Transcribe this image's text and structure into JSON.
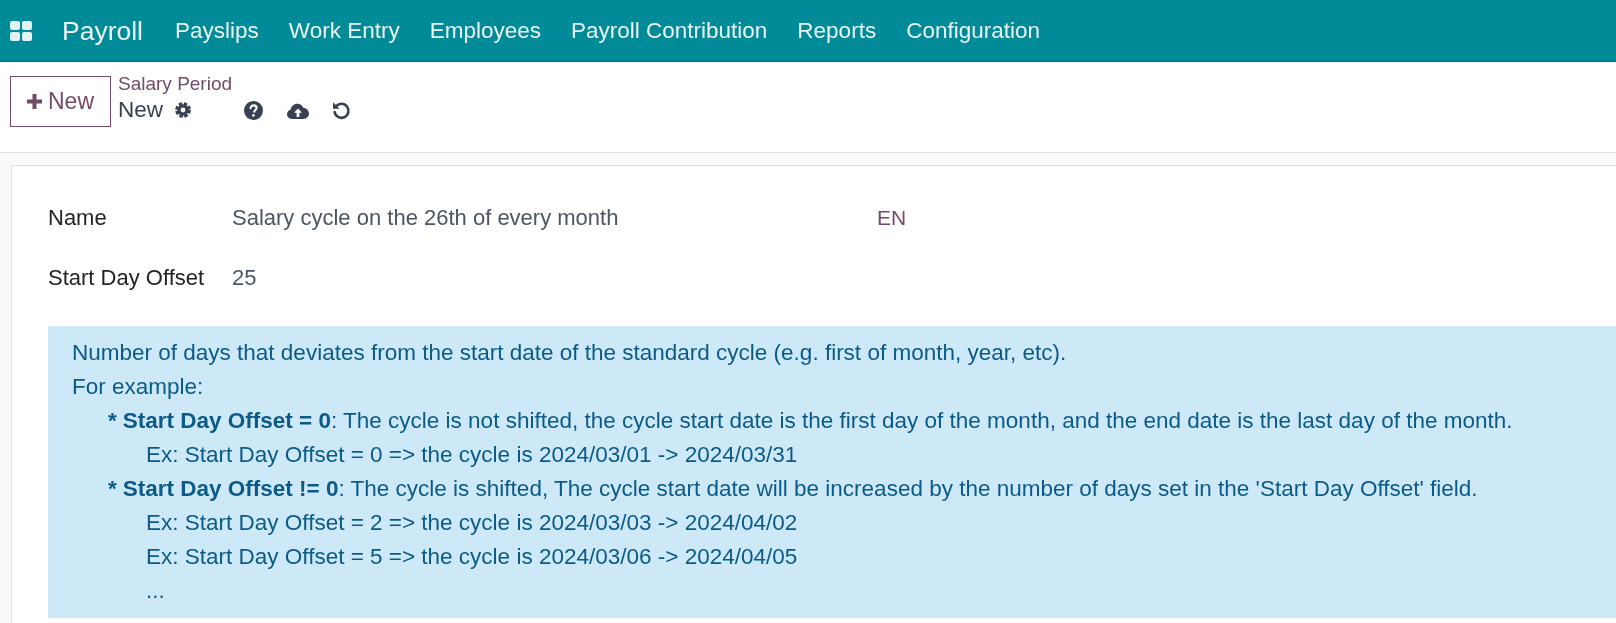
{
  "navbar": {
    "app_name": "Payroll",
    "menu": [
      {
        "label": "Payslips"
      },
      {
        "label": "Work Entry"
      },
      {
        "label": "Employees"
      },
      {
        "label": "Payroll Contribution"
      },
      {
        "label": "Reports"
      },
      {
        "label": "Configuration"
      }
    ]
  },
  "control_panel": {
    "new_button": "New",
    "breadcrumb": "Salary Period",
    "record_name": "New"
  },
  "form": {
    "fields": [
      {
        "label": "Name",
        "value": "Salary cycle on the 26th of every month",
        "translate": "EN"
      },
      {
        "label": "Start Day Offset",
        "value": "25"
      }
    ],
    "help": {
      "lines": [
        "Number of days that deviates from the start date of the standard cycle (e.g. first of month, year, etc).",
        "For example:"
      ],
      "items": [
        {
          "marker": "*",
          "text": "**Start Day Offset = 0**: The cycle is not shifted, the cycle start date is the first day of the month, and the end date is the last day of the month.",
          "children": [
            {
              "text": "Ex: Start Day Offset = 0 => the cycle is 2024/03/01 -> 2024/03/31"
            }
          ]
        },
        {
          "marker": "*",
          "text": "**Start Day Offset != 0**: The cycle is shifted, The cycle start date will be increased by the number of days set in the 'Start Day Offset' field.",
          "children": [
            {
              "text": "Ex: Start Day Offset = 2 => the cycle is 2024/03/03 -> 2024/04/02"
            },
            {
              "text": "Ex: Start Day Offset = 5 => the cycle is 2024/03/06 -> 2024/04/05"
            },
            {
              "text": "..."
            }
          ]
        }
      ]
    }
  }
}
